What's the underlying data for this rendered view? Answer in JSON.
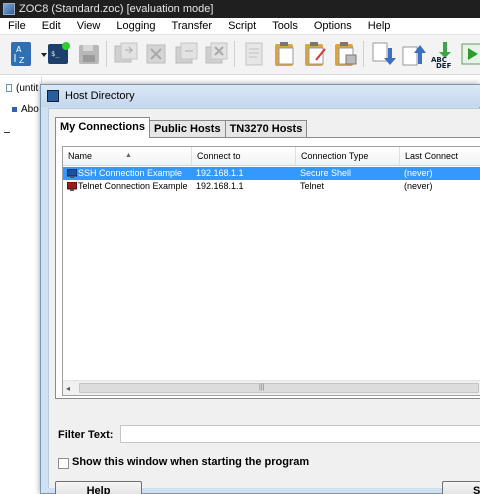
{
  "app": {
    "title": "ZOC8 (Standard.zoc) [evaluation mode]"
  },
  "menu": [
    "File",
    "Edit",
    "View",
    "Logging",
    "Transfer",
    "Script",
    "Tools",
    "Options",
    "Help"
  ],
  "toolbar": {
    "icons": [
      "sort-az-icon",
      "dropdown-arrow-icon",
      "terminal-icon",
      "disk-icon",
      "connect-icon",
      "disconnect-icon",
      "copy-icon",
      "close-session-icon",
      "document-icon",
      "clipboard-icon",
      "clipboard-edit-icon",
      "clipboard-zip-icon",
      "download-icon",
      "upload-icon",
      "abcdef-icon",
      "play-icon"
    ]
  },
  "leftpanel": {
    "tab_label": "(untit",
    "item_label": "Abo"
  },
  "dialog": {
    "title": "Host Directory",
    "tabs": [
      "My Connections",
      "Public Hosts",
      "TN3270 Hosts"
    ],
    "columns": [
      "Name",
      "Connect to",
      "Connection Type",
      "Last Connect"
    ],
    "rows": [
      {
        "name": "SSH Connection Example",
        "connect_to": "192.168.1.1",
        "type": "Secure Shell",
        "last": "(never)",
        "selected": true,
        "icon": "ssh-monitor-icon"
      },
      {
        "name": "Telnet Connection Example",
        "connect_to": "192.168.1.1",
        "type": "Telnet",
        "last": "(never)",
        "selected": false,
        "icon": "telnet-monitor-icon"
      }
    ],
    "scroll_left": "◂",
    "scroll_grip": "|||",
    "filter_label": "Filter Text:",
    "filter_value": "",
    "startup_checkbox_label": "Show this window when starting the program",
    "startup_checked": false,
    "help_label": "Help",
    "save_label_partial": "Sa"
  }
}
